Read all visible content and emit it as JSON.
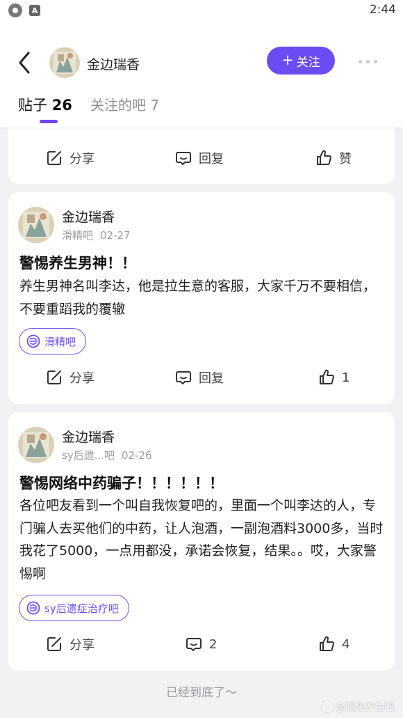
{
  "status_bar": {
    "time": "2:44",
    "notif_icon_letter": "A"
  },
  "header": {
    "user_name": "金边瑞香",
    "follow_label": "关注",
    "follow_plus": "+",
    "tab_posts_label": "贴子",
    "tab_posts_count": "26",
    "tab_bars_label": "关注的吧 7",
    "accent_color": "#6b4cf3"
  },
  "posts": [
    {
      "actions": {
        "share": "分享",
        "reply": "回复",
        "like": "赞"
      }
    },
    {
      "author": "金边瑞香",
      "bar_short": "滑精吧",
      "date": "02-27",
      "title": "警惕养生男神！！",
      "body": "养生男神名叫李达，他是拉生意的客服，大家千万不要相信，不要重蹈我的覆辙",
      "bar_tag": "滑精吧",
      "actions": {
        "share": "分享",
        "reply": "回复",
        "like": "1"
      }
    },
    {
      "author": "金边瑞香",
      "bar_short": "sy后遗...吧",
      "date": "02-26",
      "title": "警惕网络中药骗子！！！！！！",
      "body": "各位吧友看到一个叫自我恢复吧的，里面一个叫李达的人，专门骗人去买他们的中药，让人泡酒，一副泡酒料3000多，当时我花了5000，一点用都没，承诺会恢复，结果。。哎，大家警惕啊",
      "bar_tag": "sy后遗症治疗吧",
      "actions": {
        "share": "分享",
        "reply": "2",
        "like": "4"
      }
    }
  ],
  "footer": {
    "end_note": "已经到底了～",
    "watermark": "@阳色养生吧"
  }
}
